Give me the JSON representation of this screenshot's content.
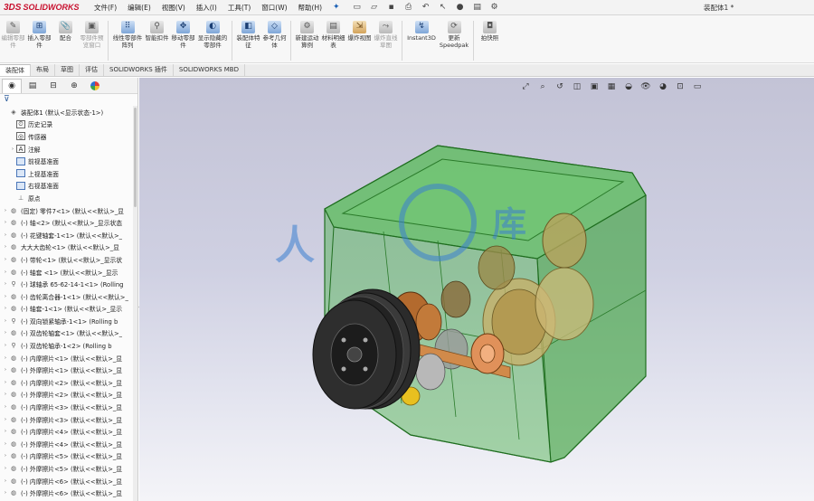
{
  "app": {
    "logo_prefix": "3DS",
    "logo_text": "SOLIDWORKS",
    "document_title": "装配体1 *"
  },
  "menu": [
    {
      "label": "文件(F)"
    },
    {
      "label": "编辑(E)"
    },
    {
      "label": "视图(V)"
    },
    {
      "label": "插入(I)"
    },
    {
      "label": "工具(T)"
    },
    {
      "label": "窗口(W)"
    },
    {
      "label": "帮助(H)"
    }
  ],
  "ribbon": [
    {
      "label": "编辑零部件",
      "icon": "edit-component-icon",
      "dim": true
    },
    {
      "label": "插入零部件",
      "icon": "insert-component-icon"
    },
    {
      "label": "配合",
      "icon": "mate-icon"
    },
    {
      "label": "零部件预览窗口",
      "icon": "preview-window-icon",
      "dim": true
    },
    {
      "label": "线性零部件阵列",
      "icon": "linear-pattern-icon"
    },
    {
      "label": "智能扣件",
      "icon": "smart-fastener-icon"
    },
    {
      "label": "移动零部件",
      "icon": "move-component-icon"
    },
    {
      "label": "显示隐藏的零部件",
      "icon": "show-hidden-icon"
    },
    {
      "label": "装配体特征",
      "icon": "assembly-feature-icon"
    },
    {
      "label": "参考几何体",
      "icon": "reference-geometry-icon"
    },
    {
      "label": "新建运动算例",
      "icon": "new-motion-study-icon"
    },
    {
      "label": "材料明细表",
      "icon": "bom-icon"
    },
    {
      "label": "爆炸视图",
      "icon": "exploded-view-icon"
    },
    {
      "label": "爆炸直线草图",
      "icon": "explode-line-sketch-icon",
      "dim": true
    },
    {
      "label": "Instant3D",
      "icon": "instant3d-icon"
    },
    {
      "label": "更新 Speedpak",
      "icon": "speedpak-icon"
    },
    {
      "label": "拍快照",
      "icon": "snapshot-icon"
    }
  ],
  "tabs": [
    {
      "label": "装配体",
      "active": true
    },
    {
      "label": "布局"
    },
    {
      "label": "草图"
    },
    {
      "label": "评估"
    },
    {
      "label": "SOLIDWORKS 插件"
    },
    {
      "label": "SOLIDWORKS MBD"
    }
  ],
  "tree": [
    {
      "label": "装配体1 (默认<显示状态-1>)",
      "icon": "assembly-icon",
      "expand": "",
      "indent": 0
    },
    {
      "label": "历史记录",
      "icon": "history-icon",
      "expand": "",
      "indent": 1
    },
    {
      "label": "传感器",
      "icon": "sensor-icon",
      "expand": "",
      "indent": 1
    },
    {
      "label": "注解",
      "icon": "annotation-icon",
      "expand": "›",
      "indent": 1
    },
    {
      "label": "前视基准面",
      "icon": "plane-icon",
      "expand": "",
      "indent": 1
    },
    {
      "label": "上视基准面",
      "icon": "plane-icon",
      "expand": "",
      "indent": 1
    },
    {
      "label": "右视基准面",
      "icon": "plane-icon",
      "expand": "",
      "indent": 1
    },
    {
      "label": "原点",
      "icon": "origin-icon",
      "expand": "",
      "indent": 1
    },
    {
      "label": "(固定) 零件7<1> (默认<<默认>_显",
      "icon": "part-icon",
      "expand": "›",
      "indent": 0
    },
    {
      "label": "(-) 轴<2> (默认<<默认>_显示状态",
      "icon": "part-icon",
      "expand": "›",
      "indent": 0
    },
    {
      "label": "(-) 花键轴套-1<1> (默认<<默认>_",
      "icon": "part-icon",
      "expand": "›",
      "indent": 0
    },
    {
      "label": "大大大齿轮<1> (默认<<默认>_显",
      "icon": "part-icon",
      "expand": "›",
      "indent": 0
    },
    {
      "label": "(-) 带轮<1> (默认<<默认>_显示状",
      "icon": "part-icon",
      "expand": "›",
      "indent": 0
    },
    {
      "label": "(-) 轴套 <1> (默认<<默认>_显示",
      "icon": "part-icon",
      "expand": "›",
      "indent": 0
    },
    {
      "label": "(-) 球轴承 65-62-14-1<1> (Rolling",
      "icon": "bearing-icon",
      "expand": "›",
      "indent": 0
    },
    {
      "label": "(-) 齿轮离合器-1<1> (默认<<默认>_",
      "icon": "part-icon",
      "expand": "›",
      "indent": 0
    },
    {
      "label": "(-) 轴套-1<1> (默认<<默认>_显示",
      "icon": "part-icon",
      "expand": "›",
      "indent": 0
    },
    {
      "label": "(-) 双向锁紧轴承-1<1> (Rolling b",
      "icon": "bearing-icon",
      "expand": "›",
      "indent": 0
    },
    {
      "label": "(-) 双齿轮轴套<1> (默认<<默认>_",
      "icon": "part-icon",
      "expand": "›",
      "indent": 0
    },
    {
      "label": "(-) 双齿轮轴承-1<2> (Rolling b",
      "icon": "bearing-icon",
      "expand": "›",
      "indent": 0
    },
    {
      "label": "(-) 内摩擦片<1> (默认<<默认>_显",
      "icon": "part-icon",
      "expand": "›",
      "indent": 0
    },
    {
      "label": "(-) 外摩擦片<1> (默认<<默认>_显",
      "icon": "part-icon",
      "expand": "›",
      "indent": 0
    },
    {
      "label": "(-) 内摩擦片<2> (默认<<默认>_显",
      "icon": "part-icon",
      "expand": "›",
      "indent": 0
    },
    {
      "label": "(-) 外摩擦片<2> (默认<<默认>_显",
      "icon": "part-icon",
      "expand": "›",
      "indent": 0
    },
    {
      "label": "(-) 内摩擦片<3> (默认<<默认>_显",
      "icon": "part-icon",
      "expand": "›",
      "indent": 0
    },
    {
      "label": "(-) 外摩擦片<3> (默认<<默认>_显",
      "icon": "part-icon",
      "expand": "›",
      "indent": 0
    },
    {
      "label": "(-) 内摩擦片<4> (默认<<默认>_显",
      "icon": "part-icon",
      "expand": "›",
      "indent": 0
    },
    {
      "label": "(-) 外摩擦片<4> (默认<<默认>_显",
      "icon": "part-icon",
      "expand": "›",
      "indent": 0
    },
    {
      "label": "(-) 内摩擦片<5> (默认<<默认>_显",
      "icon": "part-icon",
      "expand": "›",
      "indent": 0
    },
    {
      "label": "(-) 外摩擦片<5> (默认<<默认>_显",
      "icon": "part-icon",
      "expand": "›",
      "indent": 0
    },
    {
      "label": "(-) 内摩擦片<6> (默认<<默认>_显",
      "icon": "part-icon",
      "expand": "›",
      "indent": 0
    },
    {
      "label": "(-) 外摩擦片<6> (默认<<默认>_显",
      "icon": "part-icon",
      "expand": "›",
      "indent": 0
    },
    {
      "label": "(-) 内摩擦片<7> (默认<<默认>_显",
      "icon": "part-icon",
      "expand": "›",
      "indent": 0
    },
    {
      "label": "(-) 外摩擦片<4> (默认<<默认>_显",
      "icon": "part-icon",
      "expand": "›",
      "indent": 0
    }
  ],
  "colors": {
    "housing_fill": "#3fae3f",
    "housing_edge": "#1f6d1f",
    "pulley": "#2b2b2b",
    "bronze": "#b36a2e",
    "gear": "#b9a35c",
    "watermark": "#3a7fd0"
  }
}
